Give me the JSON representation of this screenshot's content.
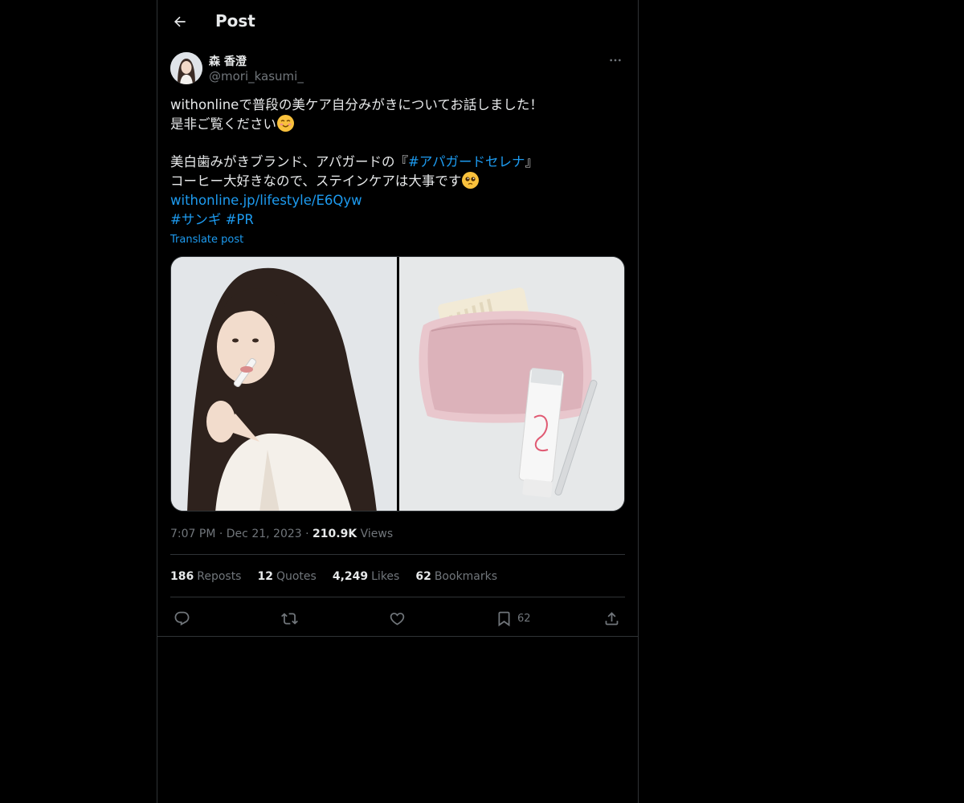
{
  "header": {
    "title": "Post"
  },
  "author": {
    "display_name": "森 香澄",
    "handle": "@mori_kasumi_"
  },
  "post": {
    "line1": "withonlineで普段の美ケア自分みがきについてお話しました！",
    "line2": "是非ご覧ください",
    "line3_prefix": "美白歯みがきブランド、アパガードの『",
    "line3_hashtag": "#アパガードセレナ",
    "line3_suffix": "』",
    "line4": "コーヒー大好きなので、ステインケアは大事です",
    "link": "withonline.jp/lifestyle/E6Qyw",
    "hashtag1": "#サンギ",
    "hashtag2": "#PR",
    "translate_label": "Translate post"
  },
  "meta": {
    "time": "7:07 PM",
    "separator": "·",
    "date": "Dec 21, 2023",
    "views_count": "210.9K",
    "views_label": "Views"
  },
  "stats": {
    "reposts_count": "186",
    "reposts_label": "Reposts",
    "quotes_count": "12",
    "quotes_label": "Quotes",
    "likes_count": "4,249",
    "likes_label": "Likes",
    "bookmarks_count": "62",
    "bookmarks_label": "Bookmarks"
  },
  "actions": {
    "bookmark_count": "62"
  },
  "colors": {
    "accent": "#1d9bf0",
    "muted": "#71767b",
    "text": "#e7e9ea",
    "border": "#2f3336"
  }
}
